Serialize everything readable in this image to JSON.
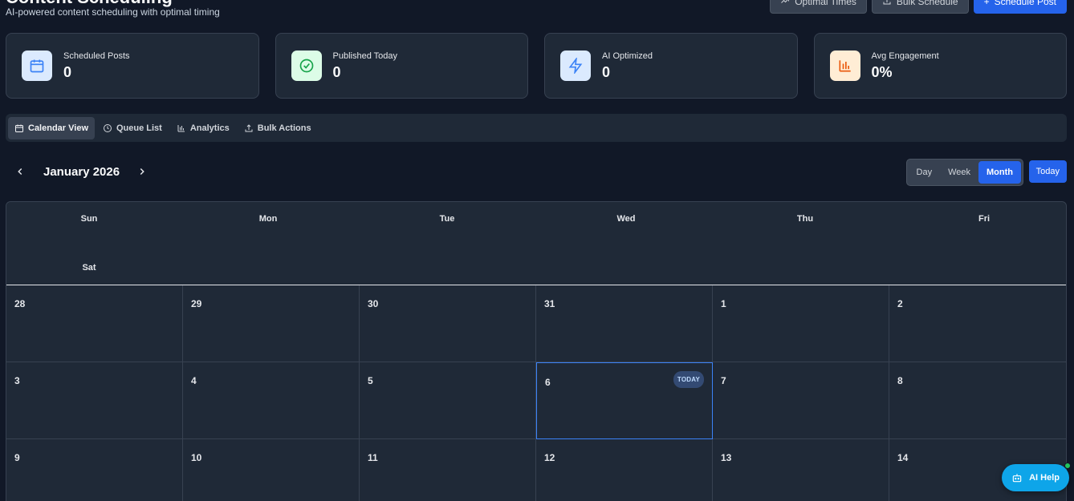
{
  "header": {
    "title": "Content Scheduling",
    "subtitle": "AI-powered content scheduling with optimal timing",
    "actions": {
      "optimal_times": "Optimal Times",
      "bulk_schedule": "Bulk Schedule",
      "schedule_post": "Schedule Post"
    }
  },
  "stats": [
    {
      "label": "Scheduled Posts",
      "value": "0",
      "icon": "calendar-icon",
      "color": "#3b82f6"
    },
    {
      "label": "Published Today",
      "value": "0",
      "icon": "check-circle-icon",
      "color": "#16a34a"
    },
    {
      "label": "AI Optimized",
      "value": "0",
      "icon": "lightning-icon",
      "color": "#3b82f6"
    },
    {
      "label": "Avg Engagement",
      "value": "0%",
      "icon": "bar-chart-icon",
      "color": "#ea580c"
    }
  ],
  "tabs": [
    {
      "label": "Calendar View",
      "icon": "calendar-icon",
      "active": true
    },
    {
      "label": "Queue List",
      "icon": "clock-icon",
      "active": false
    },
    {
      "label": "Analytics",
      "icon": "bar-chart-icon",
      "active": false
    },
    {
      "label": "Bulk Actions",
      "icon": "upload-icon",
      "active": false
    }
  ],
  "calendar": {
    "month_label": "January 2026",
    "views": [
      "Day",
      "Week",
      "Month"
    ],
    "active_view": "Month",
    "today_label": "Today",
    "weekdays": [
      "Sun",
      "Mon",
      "Tue",
      "Wed",
      "Thu",
      "Fri",
      "Sat"
    ],
    "weeks": [
      [
        "28",
        "29",
        "30",
        "31",
        "1",
        "2"
      ],
      [
        "3",
        "4",
        "5",
        "6",
        "7",
        "8"
      ],
      [
        "9",
        "10",
        "11",
        "12",
        "13",
        "14"
      ]
    ],
    "today_badge": "TODAY",
    "today_date": "6"
  },
  "ai_help": {
    "label": "AI Help"
  },
  "colors": {
    "accent": "#2563eb",
    "background": "#111827",
    "card": "#1f2937"
  }
}
